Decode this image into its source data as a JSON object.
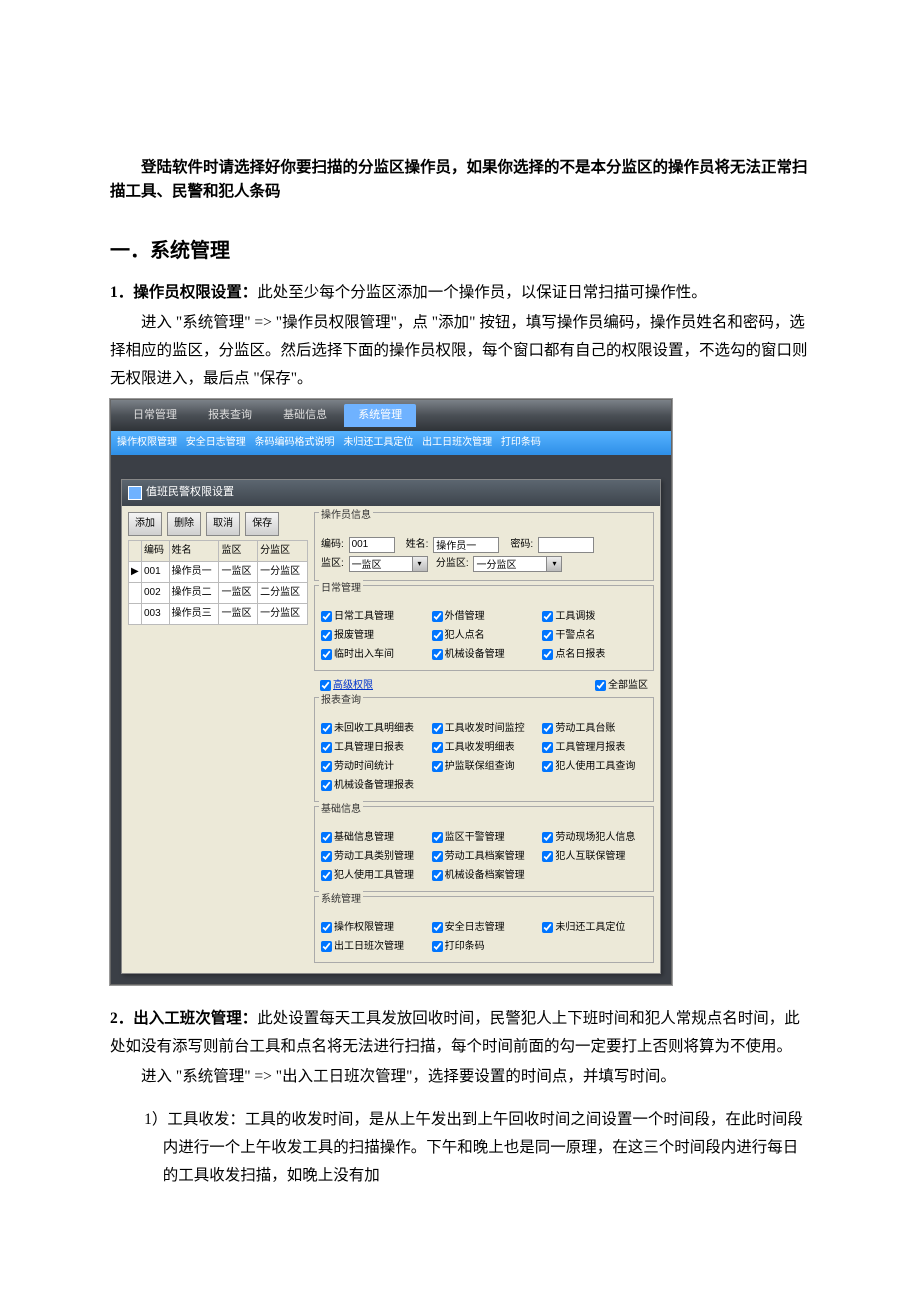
{
  "intro": "登陆软件时请选择好你要扫描的分监区操作员，如果你选择的不是本分监区的操作员将无法正常扫描工具、民警和犯人条码",
  "section1_heading": "一．系统管理",
  "item1": {
    "title": "1．操作员权限设置：",
    "desc": "此处至少每个分监区添加一个操作员，以保证日常扫描可操作性。",
    "p1": "进入 \"系统管理\" => \"操作员权限管理\"，点 \"添加\" 按钮，填写操作员编码，操作员姓名和密码，选择相应的监区，分监区。然后选择下面的操作员权限，每个窗口都有自己的权限设置，不选勾的窗口则无权限进入，最后点 \"保存\"。"
  },
  "item2": {
    "title": "2．出入工班次管理：",
    "desc": "此处设置每天工具发放回收时间，民警犯人上下班时间和犯人常规点名时间，此处如没有添写则前台工具和点名将无法进行扫描，每个时间前面的勾一定要打上否则将算为不使用。",
    "p1": "进入 \"系统管理\" => \"出入工日班次管理\"，选择要设置的时间点，并填写时间。",
    "sub1": "1）工具收发：工具的收发时间，是从上午发出到上午回收时间之间设置一个时间段，在此时间段内进行一个上午收发工具的扫描操作。下午和晚上也是同一原理，在这三个时间段内进行每日的工具收发扫描，如晚上没有加"
  },
  "ui": {
    "menubar": [
      "日常管理",
      "报表查询",
      "基础信息",
      "系统管理"
    ],
    "menubar_active_index": 3,
    "submenu": [
      "操作权限管理",
      "安全日志管理",
      "条码编码格式说明",
      "未归还工具定位",
      "出工日班次管理",
      "打印条码"
    ],
    "window_title": "值班民警权限设置",
    "toolbar": [
      "添加",
      "删除",
      "取消",
      "保存"
    ],
    "table": {
      "headers": [
        "编码",
        "姓名",
        "监区",
        "分监区"
      ],
      "rows": [
        [
          "001",
          "操作员一",
          "一监区",
          "一分监区"
        ],
        [
          "002",
          "操作员二",
          "一监区",
          "二分监区"
        ],
        [
          "003",
          "操作员三",
          "一监区",
          "一分监区"
        ]
      ]
    },
    "op_info": {
      "legend": "操作员信息",
      "code_label": "编码:",
      "code_value": "001",
      "name_label": "姓名:",
      "name_value": "操作员一",
      "pwd_label": "密码:",
      "zone_label": "监区:",
      "zone_value": "一监区",
      "subzone_label": "分监区:",
      "subzone_value": "一分监区"
    },
    "group_richang": {
      "legend": "日常管理",
      "items": [
        "日常工具管理",
        "外借管理",
        "工具调拨",
        "报废管理",
        "犯人点名",
        "干警点名",
        "临时出入车间",
        "机械设备管理",
        "点名日报表"
      ]
    },
    "special": {
      "a": "高级权限",
      "b": "全部监区"
    },
    "group_baobiao": {
      "legend": "报表查询",
      "items": [
        "未回收工具明细表",
        "工具收发时间监控",
        "劳动工具台账",
        "工具管理日报表",
        "工具收发明细表",
        "工具管理月报表",
        "劳动时间统计",
        "护监联保组查询",
        "犯人使用工具查询",
        "机械设备管理报表"
      ]
    },
    "group_jichu": {
      "legend": "基础信息",
      "items": [
        "基础信息管理",
        "监区干警管理",
        "劳动现场犯人信息",
        "劳动工具类别管理",
        "劳动工具档案管理",
        "犯人互联保管理",
        "犯人使用工具管理",
        "机械设备档案管理"
      ]
    },
    "group_xitong": {
      "legend": "系统管理",
      "items": [
        "操作权限管理",
        "安全日志管理",
        "未归还工具定位",
        "出工日班次管理",
        "打印条码"
      ]
    }
  }
}
